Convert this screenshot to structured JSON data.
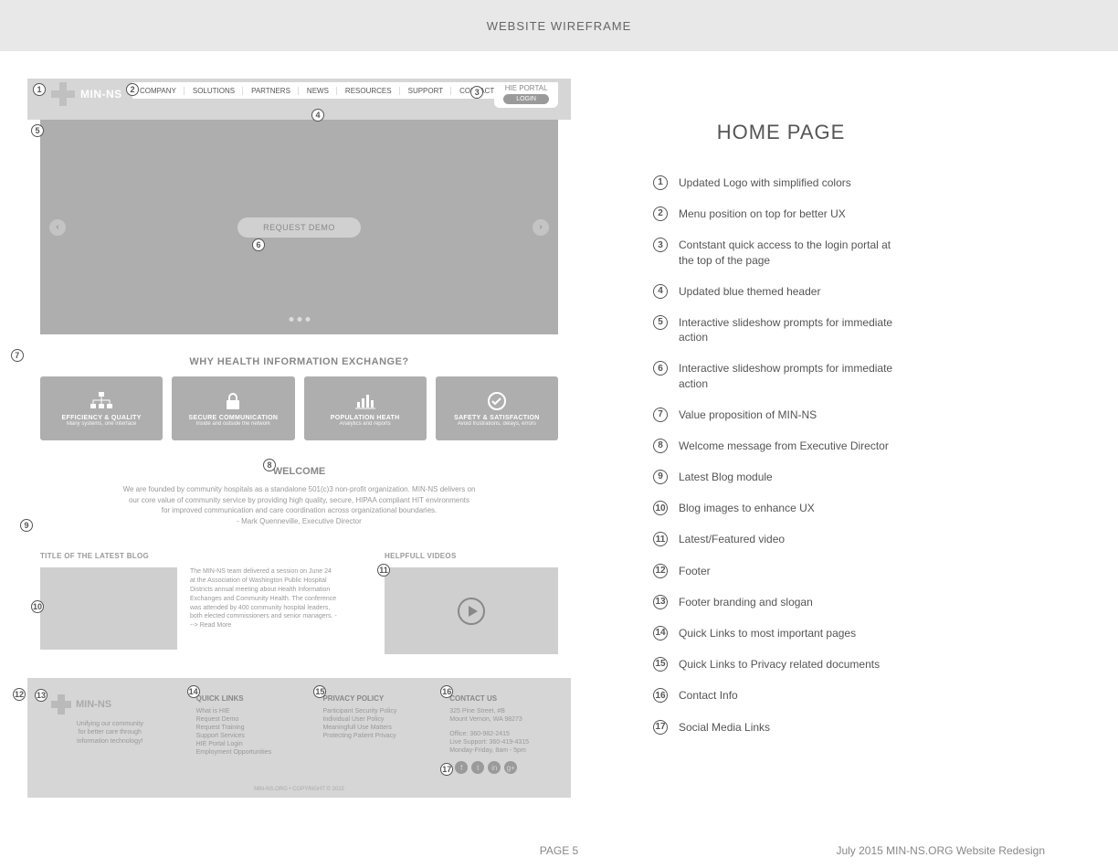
{
  "topbar": {
    "title": "WEBSITE WIREFRAME"
  },
  "sidebar": {
    "title": "HOME PAGE",
    "items": [
      "Updated Logo with simplified colors",
      "Menu position on top for better UX",
      "Contstant quick access to the login portal at the top of the page",
      "Updated blue themed header",
      "Interactive slideshow prompts for immediate action",
      "Interactive slideshow prompts for immediate action",
      "Value proposition of MIN-NS",
      "Welcome message from Executive Director",
      "Latest Blog module",
      "Blog images to enhance UX",
      "Latest/Featured video",
      "Footer",
      "Footer branding and slogan",
      "Quick Links to most important pages",
      "Quick Links to Privacy related documents",
      "Contact Info",
      "Social Media Links"
    ]
  },
  "wireframe": {
    "brand": "MIN-NS",
    "menu": [
      "COMPANY",
      "SOLUTIONS",
      "PARTNERS",
      "NEWS",
      "RESOURCES",
      "SUPPORT",
      "CONTACT"
    ],
    "portal": {
      "label": "HIE PORTAL",
      "login": "LOGIN"
    },
    "hero": {
      "cta": "REQUEST DEMO"
    },
    "why_title": "WHY HEALTH INFORMATION EXCHANGE?",
    "cards": [
      {
        "title": "EFFICIENCY & QUALITY",
        "sub": "Many systems, one interface"
      },
      {
        "title": "SECURE COMMUNICATION",
        "sub": "Inside and outside the network"
      },
      {
        "title": "POPULATION HEATH",
        "sub": "Analytics and reports"
      },
      {
        "title": "SAFETY & SATISFACTION",
        "sub": "Avoid frustrations, delays, errors"
      }
    ],
    "welcome": {
      "title": "WELCOME",
      "line1": "We are founded by community hospitals as a standalone 501(c)3 non-profit organization. MIN-NS delivers on",
      "line2": "our core value of community service by providing high quality, secure, HIPAA compliant HIT environments",
      "line3": "for improved communication and care coordination across organizational boundaries.",
      "line4": "- Mark Quenneville, Executive Director"
    },
    "blog": {
      "title": "TITLE OF THE LATEST BLOG",
      "excerpt": "The MIN-NS team delivered a session on June 24 at the Association of Washington Public Hospital Districts annual meeting about Health Information Exchanges and Community Health. The conference was attended by 400 community hospital leaders, both elected commissioners and senior managers. ---> Read More"
    },
    "videos": {
      "title": "HELPFULL VIDEOS"
    },
    "footer": {
      "slogan1": "Unifying our community",
      "slogan2": "for better care through",
      "slogan3": "information technology!",
      "quick_title": "QUICK LINKS",
      "quick_links": [
        "What is HIE",
        "Request Demo",
        "Request Training",
        "Support Services",
        "HIE Portal Login",
        "Employment Opportunities"
      ],
      "privacy_title": "PRIVACY POLICY",
      "privacy_links": [
        "Participant Security Policy",
        "Individual User Policy",
        "Meaningfull Use Matters",
        "Protecting Patient Privacy"
      ],
      "contact_title": "CONTACT US",
      "contact": [
        "325 Pine Street, #B",
        "Mount Vernon, WA 98273",
        "",
        "Office: 360-982-2415",
        "Live Support: 360-419-4315",
        "Monday-Friday, 8am - 5pm"
      ],
      "social": [
        "f",
        "t",
        "in",
        "g+"
      ],
      "copyright": "MIN-NS.ORG • COPYRIGHT © 2015"
    }
  },
  "pagefoot": {
    "center": "PAGE 5",
    "right": "July 2015 MIN-NS.ORG Website Redesign"
  }
}
